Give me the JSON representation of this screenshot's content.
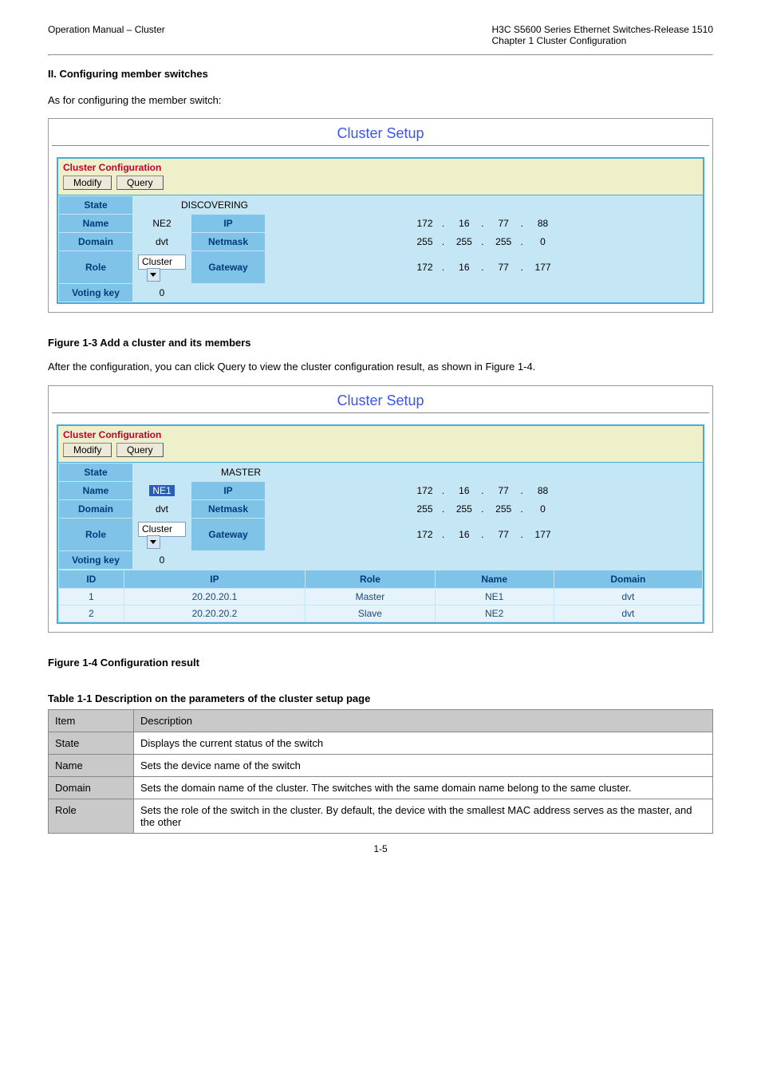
{
  "page": {
    "header_left": "Operation Manual – Cluster",
    "header_right_1": "H3C S5600 Series Ethernet Switches-Release 1510",
    "header_right_2": "Chapter 1 Cluster Configuration",
    "number": "1-5"
  },
  "intro_lines": [
    "II. Configuring member switches",
    "As for configuring the member switch:"
  ],
  "fig1": {
    "caption": "Figure 1-3 Add a cluster and its members",
    "page_title": "Cluster Setup",
    "panel_title": "Cluster Configuration",
    "buttons": {
      "modify": "Modify",
      "query": "Query"
    },
    "labels": {
      "state": "State",
      "name": "Name",
      "domain": "Domain",
      "role": "Role",
      "voting": "Voting key",
      "ip": "IP",
      "netmask": "Netmask",
      "gateway": "Gateway"
    },
    "values": {
      "state": "DISCOVERING",
      "name": "NE2",
      "domain": "dvt",
      "role": "Cluster",
      "voting": "0",
      "ip": [
        "172",
        "16",
        "77",
        "88"
      ],
      "netmask": [
        "255",
        "255",
        "255",
        "0"
      ],
      "gateway": [
        "172",
        "16",
        "77",
        "177"
      ]
    }
  },
  "mid_text": "After the configuration, you can click Query to view the cluster configuration result, as shown in Figure 1-4.",
  "fig2": {
    "caption": "Figure 1-4 Configuration result",
    "page_title": "Cluster Setup",
    "panel_title": "Cluster Configuration",
    "buttons": {
      "modify": "Modify",
      "query": "Query"
    },
    "labels": {
      "state": "State",
      "name": "Name",
      "domain": "Domain",
      "role": "Role",
      "voting": "Voting key",
      "ip": "IP",
      "netmask": "Netmask",
      "gateway": "Gateway"
    },
    "values": {
      "state": "MASTER",
      "name": "NE1",
      "domain": "dvt",
      "role": "Cluster",
      "voting": "0",
      "ip": [
        "172",
        "16",
        "77",
        "88"
      ],
      "netmask": [
        "255",
        "255",
        "255",
        "0"
      ],
      "gateway": [
        "172",
        "16",
        "77",
        "177"
      ]
    },
    "member_headers": [
      "ID",
      "IP",
      "Role",
      "Name",
      "Domain"
    ],
    "members": [
      {
        "id": "1",
        "ip": "20.20.20.1",
        "role": "Master",
        "name": "NE1",
        "domain": "dvt"
      },
      {
        "id": "2",
        "ip": "20.20.20.2",
        "role": "Slave",
        "name": "NE2",
        "domain": "dvt"
      }
    ]
  },
  "table1": {
    "caption": "Table 1-1 Description on the parameters of the cluster setup page",
    "headers": [
      "Item",
      "Description"
    ],
    "rows": [
      {
        "k": "State",
        "v": "Displays the current status of the switch"
      },
      {
        "k": "Name",
        "v": "Sets the device name of the switch"
      },
      {
        "k": "Domain",
        "v": "Sets the domain name of the cluster. The switches with the same domain name belong to the same cluster."
      },
      {
        "k": "Role",
        "v": "Sets the role of the switch in the cluster. By default, the device with the smallest MAC address serves as the master, and the other"
      }
    ]
  }
}
